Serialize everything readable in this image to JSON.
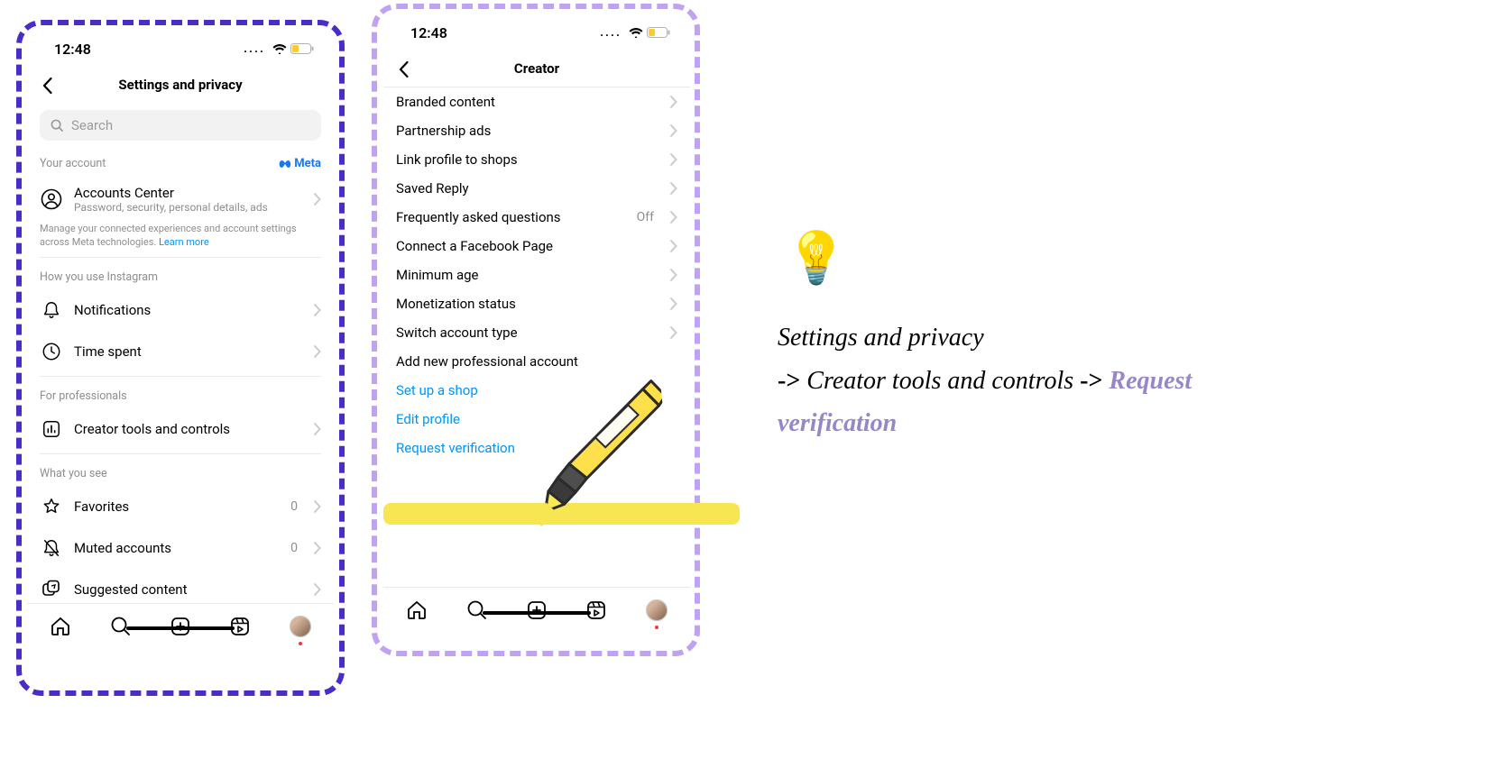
{
  "status": {
    "time": "12:48",
    "signal_dots": "...."
  },
  "phone1": {
    "title": "Settings and privacy",
    "search_placeholder": "Search",
    "section_account": "Your account",
    "meta_brand": "Meta",
    "accounts_center": {
      "title": "Accounts Center",
      "sub": "Password, security, personal details, ads"
    },
    "account_note": "Manage your connected experiences and account settings across Meta technologies. ",
    "learn_more": "Learn more",
    "section_how": "How you use Instagram",
    "notifications": "Notifications",
    "time_spent": "Time spent",
    "section_pro": "For professionals",
    "creator_tools": "Creator tools and controls",
    "section_what": "What you see",
    "favorites": "Favorites",
    "favorites_value": "0",
    "muted": "Muted accounts",
    "muted_value": "0",
    "suggested": "Suggested content"
  },
  "phone2": {
    "title": "Creator",
    "items": [
      {
        "label": "Branded content"
      },
      {
        "label": "Partnership ads"
      },
      {
        "label": "Link profile to shops"
      },
      {
        "label": "Saved Reply"
      },
      {
        "label": "Frequently asked questions",
        "value": "Off"
      },
      {
        "label": "Connect a Facebook Page"
      },
      {
        "label": "Minimum age"
      },
      {
        "label": "Monetization status"
      },
      {
        "label": "Switch account type"
      }
    ],
    "add_account": "Add new professional account",
    "links": [
      "Set up a shop",
      "Edit profile",
      "Request verification"
    ]
  },
  "callout": {
    "part1": "Settings and privacy",
    "arrow": "->",
    "part2": " Creator tools and controls ",
    "part3": "Request verification"
  }
}
